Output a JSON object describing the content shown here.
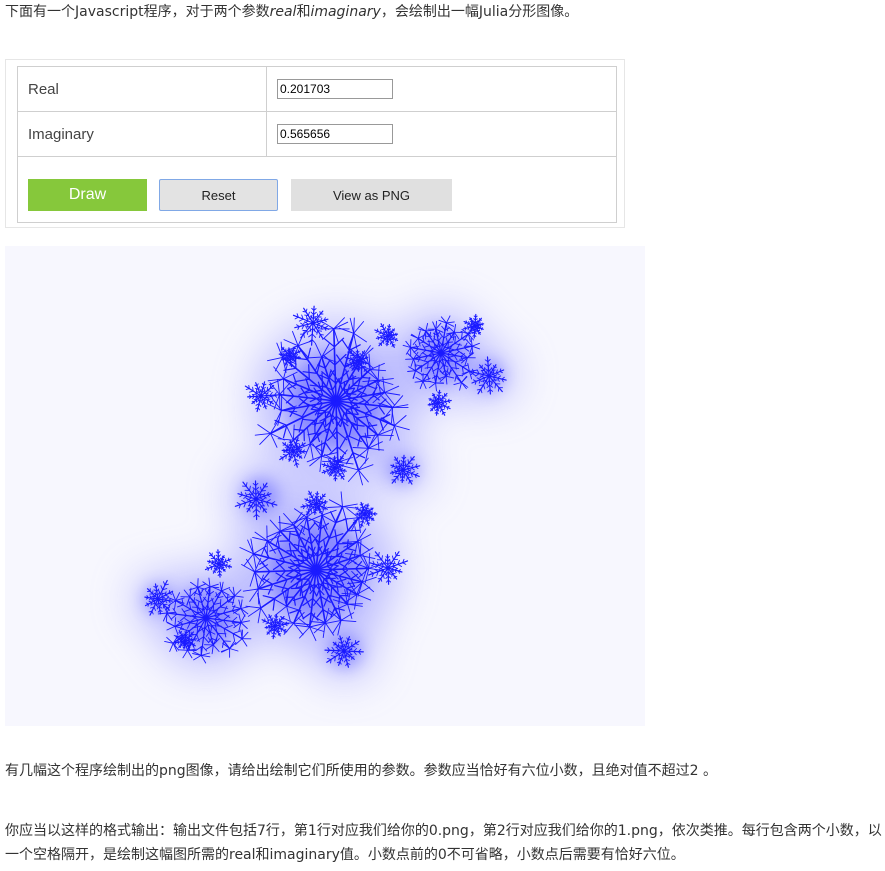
{
  "intro": {
    "prefix": "下面有一个Javascript程序，对于两个参数",
    "real_word": "real",
    "and_word": "和",
    "imag_word": "imaginary",
    "suffix": "，会绘制出一幅Julia分形图像。"
  },
  "controls": {
    "real_label": "Real",
    "real_value": "0.201703",
    "imag_label": "Imaginary",
    "imag_value": "0.565656",
    "draw_label": "Draw",
    "reset_label": "Reset",
    "png_label": "View as PNG"
  },
  "colors": {
    "draw_button": "#86c83b",
    "fractal": "#1a1aff",
    "canvas_background": "#f7f7fe"
  },
  "description": {
    "para1": "有几幅这个程序绘制出的png图像，请给出绘制它们所使用的参数。参数应当恰好有六位小数，且绝对值不超过2 。",
    "para2": "你应当以这样的格式输出：输出文件包括7行，第1行对应我们给你的0.png，第2行对应我们给你的1.png，依次类推。每行包含两个小数，以一个空格隔开，是绘制这幅图所需的real和imaginary值。小数点前的0不可省略，小数点后需要有恰好六位。"
  }
}
